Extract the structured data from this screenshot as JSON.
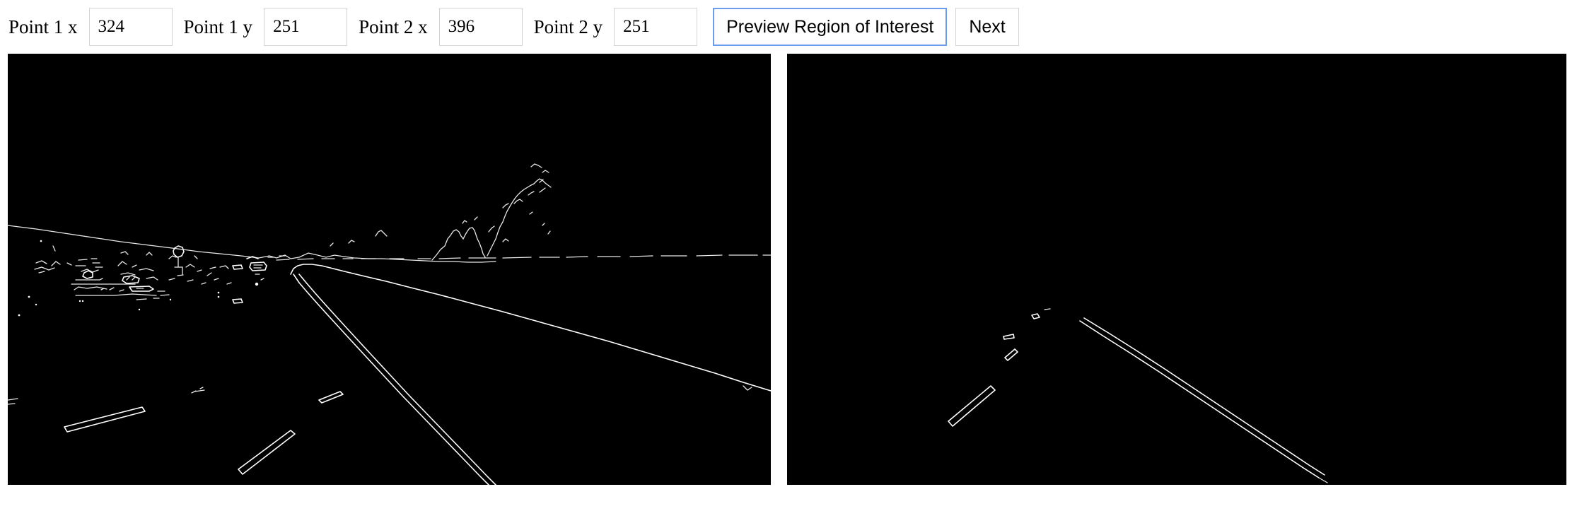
{
  "toolbar": {
    "fields": [
      {
        "label": "Point 1 x",
        "value": "324",
        "name": "point-1-x"
      },
      {
        "label": "Point 1 y",
        "value": "251",
        "name": "point-1-y"
      },
      {
        "label": "Point 2 x",
        "value": "396",
        "name": "point-2-x"
      },
      {
        "label": "Point 2 y",
        "value": "251",
        "name": "point-2-y"
      }
    ],
    "preview_button_label": "Preview Region of Interest",
    "next_button_label": "Next"
  },
  "colors": {
    "focus_border": "#6c9ded",
    "input_border": "#d4d4d4",
    "canvas_background": "#000000",
    "edge_stroke": "#ffffff",
    "page_background": "#ffffff"
  },
  "panels": {
    "left": {
      "name": "edge-detection-full-image",
      "background": "#000000"
    },
    "right": {
      "name": "edge-detection-region-of-interest",
      "background": "#000000"
    }
  }
}
